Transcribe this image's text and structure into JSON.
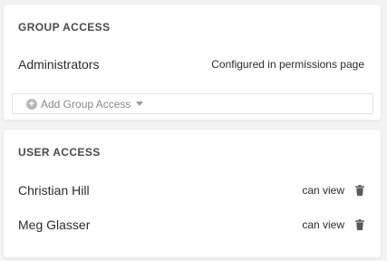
{
  "group_access": {
    "title": "GROUP ACCESS",
    "rows": [
      {
        "name": "Administrators",
        "status": "Configured in permissions page"
      }
    ],
    "add_button": {
      "plus_symbol": "+",
      "label": "Add Group Access",
      "icon": "plus-circle-icon"
    }
  },
  "user_access": {
    "title": "USER ACCESS",
    "rows": [
      {
        "name": "Christian Hill",
        "permission": "can view",
        "icon": "trash-icon"
      },
      {
        "name": "Meg Glasser",
        "permission": "can view",
        "icon": "trash-icon"
      }
    ]
  },
  "colors": {
    "background": "#f3f3f3",
    "panel": "#ffffff",
    "text": "#2b2b2b",
    "muted": "#8a8a8a"
  }
}
